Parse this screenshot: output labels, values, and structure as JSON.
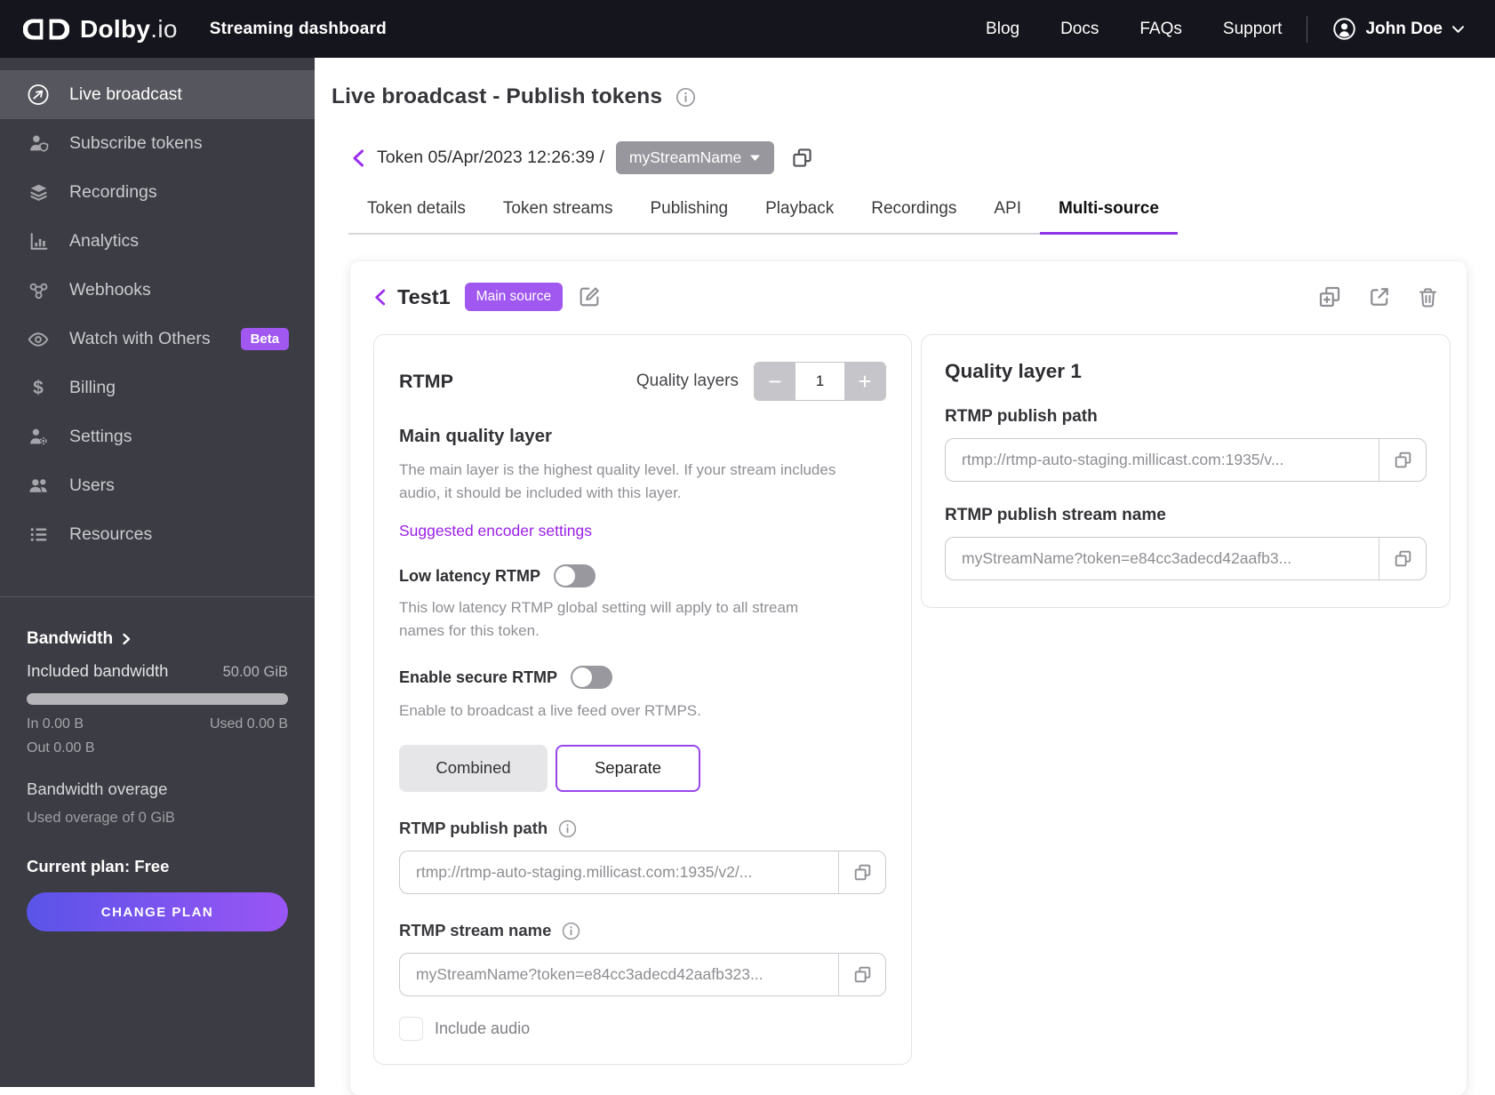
{
  "colors": {
    "topbar_bg": "#15151d",
    "sidebar_bg": "#3c3c44",
    "accent_purple": "#9b2ff0",
    "badge_purple": "#a158f0",
    "plan_gradient_start": "#5a54e8",
    "plan_gradient_end": "#9a55f5"
  },
  "topbar": {
    "brand": "Dolby",
    "brand_suffix": ".io",
    "product": "Streaming dashboard",
    "nav": [
      "Blog",
      "Docs",
      "FAQs",
      "Support"
    ],
    "user": "John Doe"
  },
  "sidebar": {
    "items": [
      {
        "label": "Live broadcast",
        "icon": "broadcast-icon",
        "active": true
      },
      {
        "label": "Subscribe tokens",
        "icon": "subscribe-tokens-icon"
      },
      {
        "label": "Recordings",
        "icon": "recordings-icon"
      },
      {
        "label": "Analytics",
        "icon": "analytics-icon"
      },
      {
        "label": "Webhooks",
        "icon": "webhooks-icon"
      },
      {
        "label": "Watch with Others",
        "icon": "watch-icon",
        "badge": "Beta"
      },
      {
        "label": "Billing",
        "icon": "billing-icon",
        "dollar": "$"
      },
      {
        "label": "Settings",
        "icon": "settings-icon"
      },
      {
        "label": "Users",
        "icon": "users-icon"
      },
      {
        "label": "Resources",
        "icon": "resources-icon"
      }
    ],
    "bandwidth": {
      "title": "Bandwidth",
      "included_label": "Included bandwidth",
      "included_value": "50.00 GiB",
      "in_text": "In 0.00 B",
      "used_text": "Used 0.00 B",
      "out_text": "Out 0.00 B",
      "overage_title": "Bandwidth overage",
      "overage_detail": "Used overage of 0 GiB",
      "plan_text": "Current plan: Free",
      "change_plan": "CHANGE PLAN"
    }
  },
  "main": {
    "title": "Live broadcast - Publish tokens",
    "breadcrumb": {
      "token": "Token 05/Apr/2023 12:26:39 /",
      "stream": "myStreamName"
    },
    "tabs": [
      "Token details",
      "Token streams",
      "Publishing",
      "Playback",
      "Recordings",
      "API",
      "Multi-source"
    ],
    "active_tab": "Multi-source",
    "card": {
      "name": "Test1",
      "badge": "Main source",
      "rtmp": {
        "title": "RTMP",
        "quality_layers_label": "Quality layers",
        "quality_layers_value": "1",
        "decrement": "−",
        "increment": "+",
        "main_layer_title": "Main quality layer",
        "main_layer_desc": "The main layer is the highest quality level. If your stream includes audio, it should be included with this layer.",
        "encoder_link": "Suggested encoder settings",
        "low_latency_label": "Low latency RTMP",
        "low_latency_desc": "This low latency RTMP global setting will apply to all stream names for this token.",
        "secure_label": "Enable secure RTMP",
        "secure_desc": "Enable to broadcast a live feed over RTMPS.",
        "combined_btn": "Combined",
        "separate_btn": "Separate",
        "publish_path_label": "RTMP publish path",
        "publish_path_value": "rtmp://rtmp-auto-staging.millicast.com:1935/v2/...",
        "stream_name_label": "RTMP stream name",
        "stream_name_value": "myStreamName?token=e84cc3adecd42aafb323...",
        "include_audio_label": "Include audio"
      },
      "quality_layer": {
        "title": "Quality layer 1",
        "publish_path_label": "RTMP publish path",
        "publish_path_value": "rtmp://rtmp-auto-staging.millicast.com:1935/v...",
        "stream_name_label": "RTMP publish stream name",
        "stream_name_value": "myStreamName?token=e84cc3adecd42aafb3..."
      }
    }
  }
}
